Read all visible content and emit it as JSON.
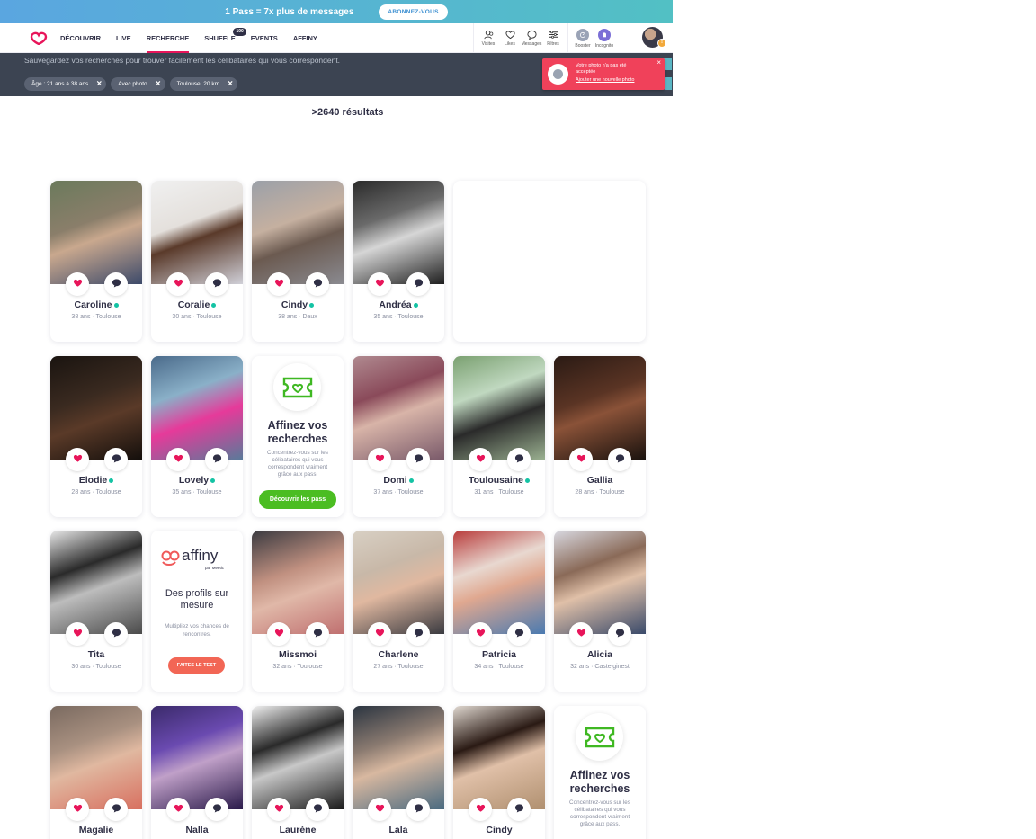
{
  "promo_bar": {
    "text": "1 Pass = 7x plus de messages",
    "button": "ABONNEZ-VOUS"
  },
  "nav": {
    "links": [
      "DÉCOUVRIR",
      "LIVE",
      "RECHERCHE",
      "SHUFFLE",
      "EVENTS",
      "AFFINY"
    ],
    "active": "RECHERCHE",
    "shuffle_badge": "100",
    "icons": [
      {
        "label": "Visites",
        "icon": "visits-icon"
      },
      {
        "label": "Likes",
        "icon": "heart-icon"
      },
      {
        "label": "Messages",
        "icon": "message-icon"
      },
      {
        "label": "Filtres",
        "icon": "filters-icon"
      }
    ],
    "boost_icons": [
      {
        "label": "Booster",
        "icon": "booster-icon"
      },
      {
        "label": "Incognito",
        "icon": "incognito-icon"
      }
    ],
    "avatar_badge": "!"
  },
  "search": {
    "text": "Sauvegardez vos recherches pour trouver facilement les célibataires qui vous correspondent.",
    "chips": [
      "Âge : 21 ans à 38 ans",
      "Avec photo",
      "Toulouse, 20 km"
    ]
  },
  "toast": {
    "message": "Votre photo n'a pas été acceptée",
    "link": "Ajouter une nouvelle photo"
  },
  "results": ">2640 résultats",
  "promo_card": {
    "title": "Affinez vos recherches",
    "desc": "Concentrez-vous sur les célibataires qui vous correspondent vraiment grâce aux pass.",
    "button": "Découvrir les pass"
  },
  "affiny_card": {
    "logo": "affiny",
    "logo_sub": "par Meetic",
    "title": "Des profils sur mesure",
    "desc": "Multipliez vos chances de rencontres.",
    "button": "FAITES LE TEST"
  },
  "profiles": [
    {
      "name": "Caroline",
      "info": "38 ans · Toulouse",
      "online": true
    },
    {
      "name": "Coralie",
      "info": "30 ans · Toulouse",
      "online": true
    },
    {
      "name": "Cindy",
      "info": "38 ans · Daux",
      "online": true
    },
    {
      "name": "Andréa",
      "info": "35 ans · Toulouse",
      "online": true
    },
    {
      "name": "Elodie",
      "info": "28 ans · Toulouse",
      "online": true
    },
    {
      "name": "Lovely",
      "info": "35 ans · Toulouse",
      "online": true
    },
    {
      "name": "Domi",
      "info": "37 ans · Toulouse",
      "online": true
    },
    {
      "name": "Toulousaine",
      "info": "31 ans · Toulouse",
      "online": true
    },
    {
      "name": "Gallia",
      "info": "28 ans · Toulouse",
      "online": false
    },
    {
      "name": "Tita",
      "info": "30 ans · Toulouse",
      "online": false
    },
    {
      "name": "Missmoi",
      "info": "32 ans · Toulouse",
      "online": false
    },
    {
      "name": "Charlene",
      "info": "27 ans · Toulouse",
      "online": false
    },
    {
      "name": "Patricia",
      "info": "34 ans · Toulouse",
      "online": false
    },
    {
      "name": "Alicia",
      "info": "32 ans · Castelginest",
      "online": false
    },
    {
      "name": "Magalie",
      "info": "",
      "online": false
    },
    {
      "name": "Nalla",
      "info": "",
      "online": false
    },
    {
      "name": "Laurène",
      "info": "",
      "online": false
    },
    {
      "name": "Lala",
      "info": "",
      "online": false
    },
    {
      "name": "Cindy",
      "info": "",
      "online": false
    }
  ],
  "colors": {
    "brand": "#e8155a",
    "online": "#14c3a4",
    "pass_green": "#4bbd22",
    "affiny_orange": "#f26655",
    "band": "#3c4452"
  }
}
